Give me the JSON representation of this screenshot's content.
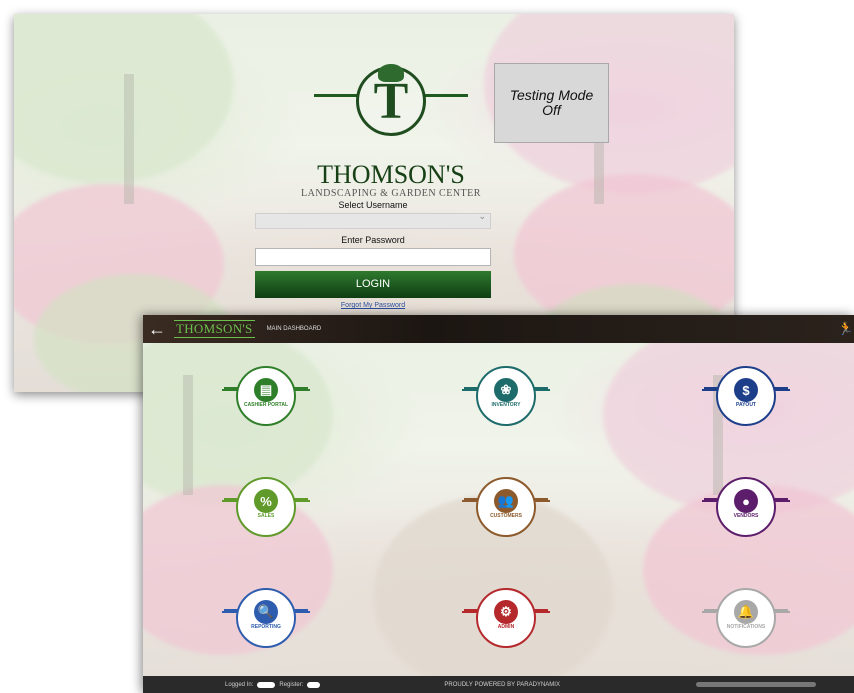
{
  "login": {
    "brand": {
      "name": "THOMSON'S",
      "subtitle": "LANDSCAPING & GARDEN CENTER",
      "letter": "T"
    },
    "testing_mode": "Testing Mode Off",
    "username_label": "Select Username",
    "username_value": "",
    "password_label": "Enter Password",
    "password_value": "",
    "login_button": "LOGIN",
    "forgot_link": "Forgot My Password"
  },
  "dashboard": {
    "back_icon": "arrow-left-icon",
    "brand": "THOMSON'S",
    "breadcrumb": "MAIN DASHBOARD",
    "exit_icon": "running-person-icon",
    "tiles": [
      {
        "label": "CASHIER PORTAL",
        "icon": "cash-register-icon",
        "glyph": "▤",
        "color": "#2f7f2a"
      },
      {
        "label": "INVENTORY",
        "icon": "tree-icon",
        "glyph": "❀",
        "color": "#1e6b6b"
      },
      {
        "label": "PAYOUT",
        "icon": "money-icon",
        "glyph": "$",
        "color": "#1d3f8a"
      },
      {
        "label": "SALES",
        "icon": "price-tag-icon",
        "glyph": "%",
        "color": "#5f9a2a"
      },
      {
        "label": "CUSTOMERS",
        "icon": "people-icon",
        "glyph": "👥",
        "color": "#8c5a2c"
      },
      {
        "label": "VENDORS",
        "icon": "person-icon",
        "glyph": "●",
        "color": "#5c1e6b"
      },
      {
        "label": "REPORTING",
        "icon": "report-search-icon",
        "glyph": "🔍",
        "color": "#2e5cae"
      },
      {
        "label": "ADMIN",
        "icon": "gears-icon",
        "glyph": "⚙",
        "color": "#b5282c"
      },
      {
        "label": "NOTIFICATIONS",
        "icon": "bell-icon",
        "glyph": "🔔",
        "color": "#a8a8a8"
      }
    ],
    "footer": {
      "logged_in": "Logged In:",
      "register": "Register:",
      "powered_by": "PROUDLY POWERED BY PARADYNAMIX"
    }
  }
}
